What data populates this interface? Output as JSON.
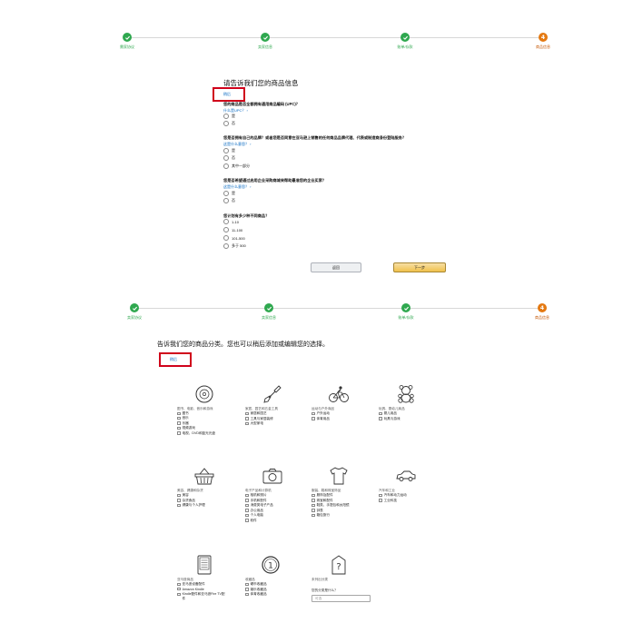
{
  "steps_top": [
    {
      "label": "需家协议",
      "status": "done"
    },
    {
      "label": "卖家信息",
      "status": "done"
    },
    {
      "label": "账单/存款",
      "status": "done"
    },
    {
      "label": "商品信息",
      "status": "current",
      "number": "4"
    }
  ],
  "product_info": {
    "title": "请告诉我们您的商品信息",
    "skip": "稍后",
    "questions": [
      {
        "text": "您的商品是否全都拥有通用商品编码 (UPC)？",
        "hint": "什么是UPC？ ›",
        "options": [
          "是",
          "否"
        ]
      },
      {
        "text": "您是否拥有自己的品牌？或者您是否同意在亚马逊上销售的任何商品品牌代理、代表或制造商身份登陆服务？",
        "hint": "这是什么意思？ ›",
        "options": [
          "是",
          "否",
          "其中一部分"
        ]
      },
      {
        "text": "您是否希望通过启用企业采购商城来帮助最准您的企业买家？",
        "hint": "这是什么意思？ ›",
        "options": [
          "是",
          "否"
        ]
      },
      {
        "text": "您计划有多少种不同商品？",
        "hint": "",
        "options": [
          "1-10",
          "11-100",
          "101-500",
          "多于 500"
        ]
      }
    ],
    "back_label": "返回",
    "next_label": "下一步"
  },
  "steps_bottom": [
    {
      "label": "卖家协议",
      "status": "done"
    },
    {
      "label": "卖家信息",
      "status": "done"
    },
    {
      "label": "账单/存款",
      "status": "done"
    },
    {
      "label": "商品信息",
      "status": "current",
      "number": "4"
    }
  ],
  "category": {
    "title": "告诉我们您的商品分类。您也可以稍后添加或编辑您的选择。",
    "skip": "稍后",
    "groups": [
      {
        "icon": "disc-icon",
        "heading": "图书、电影、音乐和游戏",
        "items": [
          "图书",
          "音乐",
          "乐器",
          "视频游戏",
          "电视、DVD和蓝光光盘"
        ]
      },
      {
        "icon": "shovel-icon",
        "heading": "家居、园艺和五金工具",
        "items": [
          "家居和园艺",
          "工具与家居装修",
          "大型家电"
        ]
      },
      {
        "icon": "cyclist-icon",
        "heading": "运动与户外商品",
        "items": [
          "户外运动",
          "体育用品"
        ]
      },
      {
        "icon": "teddy-bear-icon",
        "heading": "玩具、婴幼儿商品",
        "items": [
          "婴儿用品",
          "玩具与游戏"
        ]
      },
      {
        "icon": "basket-icon",
        "heading": "美容、健康和杂货",
        "items": [
          "美容",
          "杂货食品",
          "健康与个人护理"
        ]
      },
      {
        "icon": "camera-icon",
        "heading": "电子产品和计算机",
        "items": [
          "相机和照片",
          "手机和配件",
          "消费类电子产品",
          "办公用品",
          "个人电脑",
          "软件"
        ]
      },
      {
        "icon": "shirt-icon",
        "heading": "服装、鞋和珠宝饰品",
        "items": [
          "服饰及配件",
          "珠宝和配件",
          "鞋类、手提包和太阳镜",
          "钟表",
          "箱包旅行"
        ]
      },
      {
        "icon": "car-icon",
        "heading": "汽车和工业",
        "items": [
          "汽车和动力运动",
          "工业科技"
        ]
      },
      {
        "icon": "kindle-icon",
        "heading": "亚马逊商品",
        "items": [
          "亚马逊设备配件",
          "Amazon Kindle",
          "Kindle配件和亚马逊Fire TV配件"
        ]
      },
      {
        "icon": "coin-icon",
        "heading": "收藏品",
        "items": [
          "硬币收藏品",
          "娱乐收藏品",
          "体育收藏品"
        ]
      }
    ],
    "other": {
      "heading": "未列出分类",
      "question": "您的分类是什么？",
      "placeholder": "可选"
    }
  },
  "colors": {
    "done": "#2fa84f",
    "current": "#e47911",
    "link": "#0066c0",
    "highlight": "#d0021b",
    "next_button": "#f0c14b"
  }
}
